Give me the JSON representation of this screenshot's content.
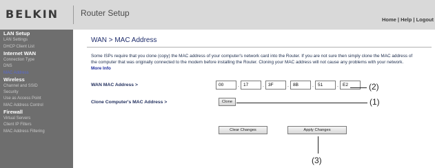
{
  "header": {
    "logo": "BELKIN",
    "app_title": "Router Setup",
    "links": "Home | Help | Logout"
  },
  "sidebar": {
    "items": [
      {
        "label": "LAN Setup",
        "type": "section"
      },
      {
        "label": "LAN Settings",
        "type": "item"
      },
      {
        "label": "DHCP Client List",
        "type": "item"
      },
      {
        "label": "Internet WAN",
        "type": "section"
      },
      {
        "label": "Connection Type",
        "type": "item"
      },
      {
        "label": "DNS",
        "type": "item"
      },
      {
        "label": "MAC Address",
        "type": "item",
        "active": true
      },
      {
        "label": "Wireless",
        "type": "section"
      },
      {
        "label": "Channel and SSID",
        "type": "item"
      },
      {
        "label": "Security",
        "type": "item"
      },
      {
        "label": "Use as Access Point",
        "type": "item"
      },
      {
        "label": "MAC Address Control",
        "type": "item"
      },
      {
        "label": "Firewall",
        "type": "section"
      },
      {
        "label": "Virtual Servers",
        "type": "item"
      },
      {
        "label": "Client IP Filters",
        "type": "item"
      },
      {
        "label": "MAC Address Filtering",
        "type": "item"
      }
    ]
  },
  "main": {
    "title": "WAN > MAC Address",
    "description": "Some ISPs require that you clone (copy) the MAC address of your computer's network card into the Router. If you are not sure then simply clone the MAC address of the computer that was originally connected to the modem before installing the Router. Cloning your MAC address will not cause any problems with your network.",
    "more_info": "More Info",
    "wan_mac_label": "WAN MAC Address >",
    "mac_octets": [
      "00",
      "17",
      "3F",
      "8B",
      "51",
      "E2"
    ],
    "clone_label": "Clone Computer's MAC Address >",
    "clone_button": "Clone",
    "clear_button": "Clear Changes",
    "apply_button": "Apply Changes"
  },
  "callouts": {
    "mac": "(2)",
    "clone": "(1)",
    "apply": "(3)"
  },
  "colors": {
    "header_bg": "#d9d9d9",
    "sidebar_bg": "#6e6e6e",
    "active_link": "#5a6ad0",
    "title": "#1e2c6b"
  }
}
